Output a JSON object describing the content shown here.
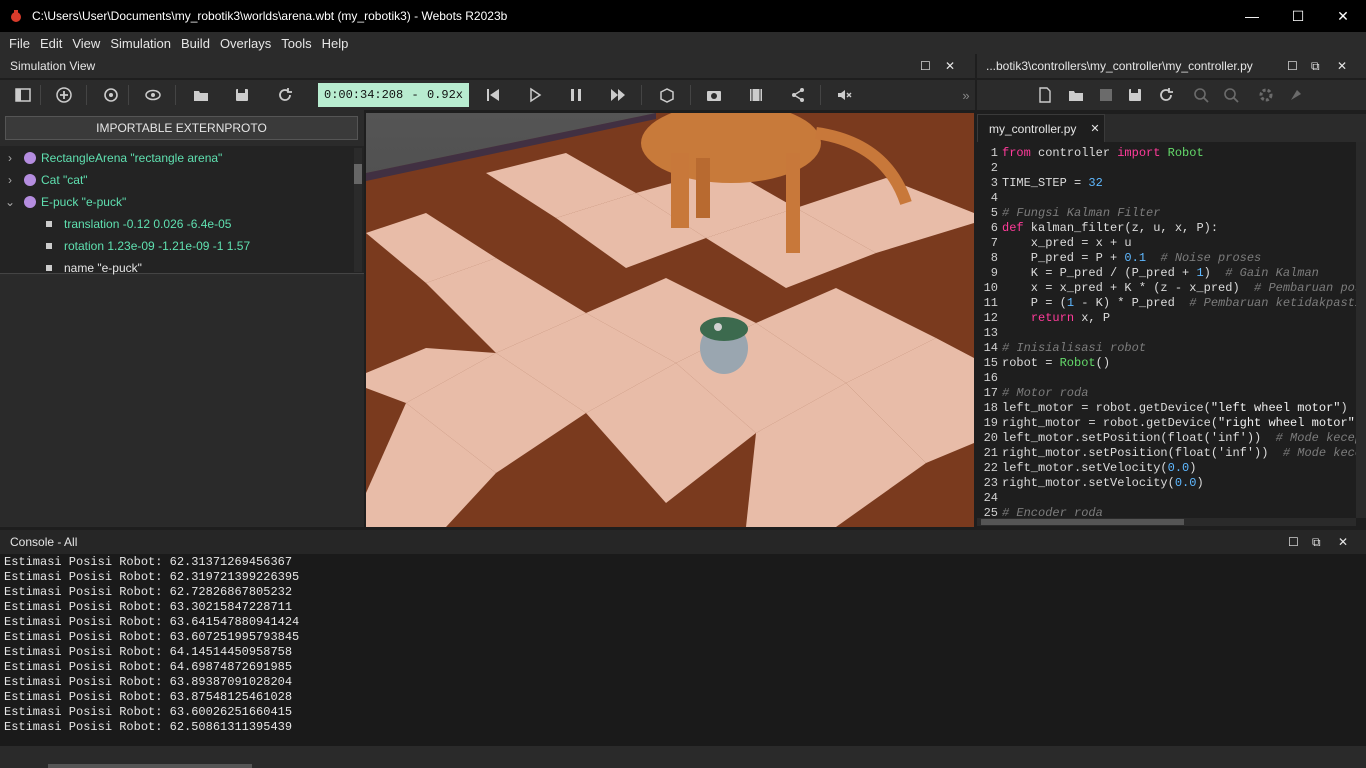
{
  "window": {
    "title": "C:\\Users\\User\\Documents\\my_robotik3\\worlds\\arena.wbt (my_robotik3) - Webots R2023b",
    "minimize": "—",
    "maximize": "☐",
    "close": "✕"
  },
  "menu": [
    "File",
    "Edit",
    "View",
    "Simulation",
    "Build",
    "Overlays",
    "Tools",
    "Help"
  ],
  "simulation_view": {
    "title": "Simulation View",
    "time": "0:00:34:208",
    "time_sep": "-",
    "speed": "0.92x"
  },
  "scene_tree": {
    "importable_button": "IMPORTABLE EXTERNPROTO",
    "nodes": [
      {
        "label": "RectangleArena \"rectangle arena\"",
        "expander": "›"
      },
      {
        "label": "Cat \"cat\"",
        "expander": "›"
      },
      {
        "label": "E-puck \"e-puck\"",
        "expander": "⌄"
      }
    ],
    "fields": [
      {
        "label": "translation -0.12 0.026 -6.4e-05"
      },
      {
        "label": "rotation 1.23e-09 -1.21e-09 -1 1.57"
      },
      {
        "label": "name \"e-puck\""
      }
    ]
  },
  "editor": {
    "title": "...botik3\\controllers\\my_controller\\my_controller.py",
    "tab": "my_controller.py",
    "tab_close": "✕",
    "lines": [
      {
        "n": "1",
        "parts": [
          [
            "kw",
            "from"
          ],
          [
            "t",
            " controller "
          ],
          [
            "kw",
            "import"
          ],
          [
            "t",
            " "
          ],
          [
            "cls",
            "Robot"
          ]
        ]
      },
      {
        "n": "2",
        "parts": []
      },
      {
        "n": "3",
        "parts": [
          [
            "t",
            "TIME_STEP = "
          ],
          [
            "num",
            "32"
          ]
        ]
      },
      {
        "n": "4",
        "parts": []
      },
      {
        "n": "5",
        "parts": [
          [
            "cmt",
            "# Fungsi Kalman Filter"
          ]
        ]
      },
      {
        "n": "6",
        "parts": [
          [
            "kw",
            "def"
          ],
          [
            "t",
            " kalman_filter(z, u, x, P):"
          ]
        ]
      },
      {
        "n": "7",
        "parts": [
          [
            "t",
            "    x_pred = x + u"
          ]
        ]
      },
      {
        "n": "8",
        "parts": [
          [
            "t",
            "    P_pred = P + "
          ],
          [
            "num",
            "0.1"
          ],
          [
            "t",
            "  "
          ],
          [
            "cmt",
            "# Noise proses"
          ]
        ]
      },
      {
        "n": "9",
        "parts": [
          [
            "t",
            "    K = P_pred / (P_pred + "
          ],
          [
            "num",
            "1"
          ],
          [
            "t",
            ")  "
          ],
          [
            "cmt",
            "# Gain Kalman"
          ]
        ]
      },
      {
        "n": "10",
        "parts": [
          [
            "t",
            "    x = x_pred + K * (z - x_pred)  "
          ],
          [
            "cmt",
            "# Pembaruan posisi"
          ]
        ]
      },
      {
        "n": "11",
        "parts": [
          [
            "t",
            "    P = ("
          ],
          [
            "num",
            "1"
          ],
          [
            "t",
            " - K) * P_pred  "
          ],
          [
            "cmt",
            "# Pembaruan ketidakpastian"
          ]
        ]
      },
      {
        "n": "12",
        "parts": [
          [
            "t",
            "    "
          ],
          [
            "kw",
            "return"
          ],
          [
            "t",
            " x, P"
          ]
        ]
      },
      {
        "n": "13",
        "parts": []
      },
      {
        "n": "14",
        "parts": [
          [
            "cmt",
            "# Inisialisasi robot"
          ]
        ]
      },
      {
        "n": "15",
        "parts": [
          [
            "t",
            "robot = "
          ],
          [
            "cls",
            "Robot"
          ],
          [
            "t",
            "()"
          ]
        ]
      },
      {
        "n": "16",
        "parts": []
      },
      {
        "n": "17",
        "parts": [
          [
            "cmt",
            "# Motor roda"
          ]
        ]
      },
      {
        "n": "18",
        "parts": [
          [
            "t",
            "left_motor = robot.getDevice("
          ],
          [
            "str",
            "\"left wheel motor\""
          ],
          [
            "t",
            ")"
          ]
        ]
      },
      {
        "n": "19",
        "parts": [
          [
            "t",
            "right_motor = robot.getDevice("
          ],
          [
            "str",
            "\"right wheel motor\""
          ],
          [
            "t",
            ")"
          ]
        ]
      },
      {
        "n": "20",
        "parts": [
          [
            "t",
            "left_motor.setPosition(float('inf'))  "
          ],
          [
            "cmt",
            "# Mode kecepatan"
          ]
        ]
      },
      {
        "n": "21",
        "parts": [
          [
            "t",
            "right_motor.setPosition(float('inf'))  "
          ],
          [
            "cmt",
            "# Mode kecepatan"
          ]
        ]
      },
      {
        "n": "22",
        "parts": [
          [
            "t",
            "left_motor.setVelocity("
          ],
          [
            "num",
            "0.0"
          ],
          [
            "t",
            ")"
          ]
        ]
      },
      {
        "n": "23",
        "parts": [
          [
            "t",
            "right_motor.setVelocity("
          ],
          [
            "num",
            "0.0"
          ],
          [
            "t",
            ")"
          ]
        ]
      },
      {
        "n": "24",
        "parts": []
      },
      {
        "n": "25",
        "parts": [
          [
            "cmt",
            "# Encoder roda"
          ]
        ]
      }
    ]
  },
  "console": {
    "title": "Console - All",
    "lines": [
      "Estimasi Posisi Robot: 62.31371269456367",
      "Estimasi Posisi Robot: 62.319721399226395",
      "Estimasi Posisi Robot: 62.72826867805232",
      "Estimasi Posisi Robot: 63.30215847228711",
      "Estimasi Posisi Robot: 63.641547880941424",
      "Estimasi Posisi Robot: 63.607251995793845",
      "Estimasi Posisi Robot: 64.14514450958758",
      "Estimasi Posisi Robot: 64.69874872691985",
      "Estimasi Posisi Robot: 63.89387091028204",
      "Estimasi Posisi Robot: 63.87548125461028",
      "Estimasi Posisi Robot: 63.60026251660415",
      "Estimasi Posisi Robot: 62.50861311395439"
    ]
  },
  "colors": {
    "scene_node": "#5fe0b0",
    "field_text": "#5fe0b0",
    "time_bg": "#b8ecd0"
  }
}
